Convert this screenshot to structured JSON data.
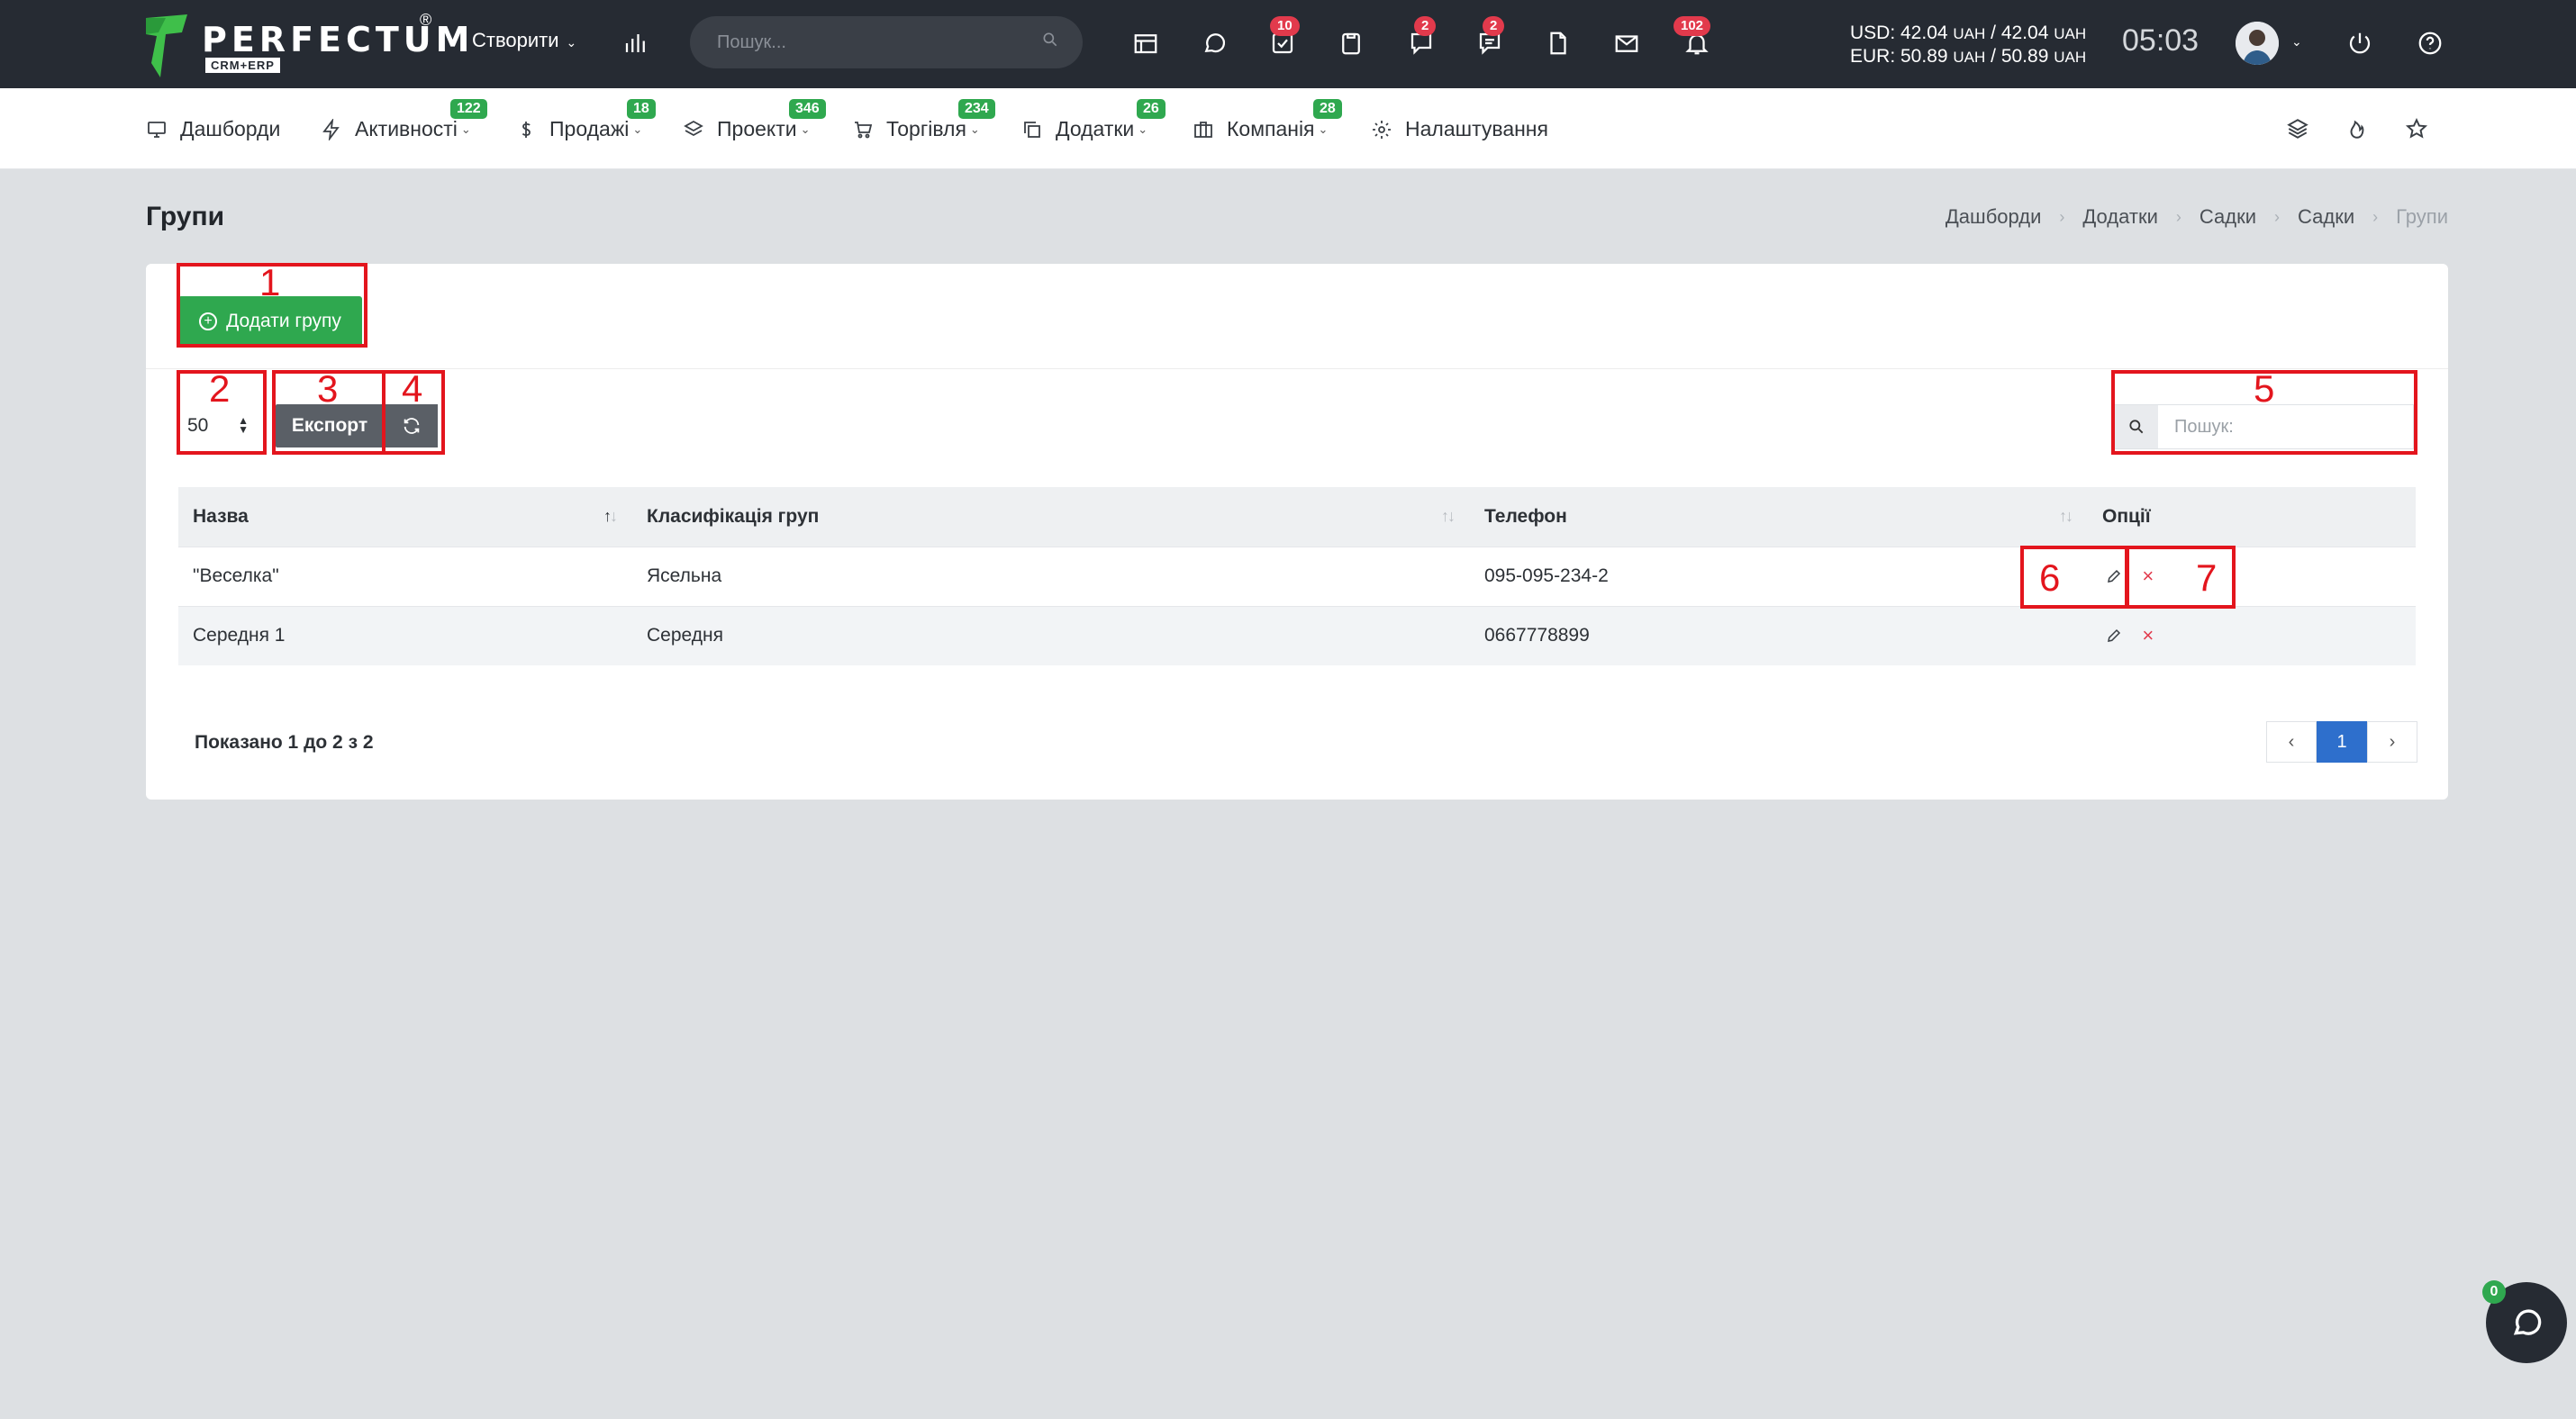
{
  "topbar": {
    "logo_text": "PERFECTUM",
    "logo_reg": "®",
    "logo_sub": "CRM+ERP",
    "create_label": "Створити",
    "search_placeholder": "Пошук...",
    "badges": {
      "tasks": "10",
      "chats": "2",
      "comments": "2",
      "notifications": "102"
    },
    "rates": {
      "usd": "USD: 42.04",
      "usd_mid": "/ 42.04",
      "eur": "EUR: 50.89",
      "eur_mid": "/ 50.89",
      "unit": "UAH"
    },
    "clock": "05:03"
  },
  "nav": {
    "items": [
      {
        "label": "Дашборди",
        "icon": "monitor-icon",
        "badge": ""
      },
      {
        "label": "Активності",
        "icon": "lightning-icon",
        "badge": "122"
      },
      {
        "label": "Продажі",
        "icon": "dollar-icon",
        "badge": "18"
      },
      {
        "label": "Проекти",
        "icon": "layers-icon",
        "badge": "346"
      },
      {
        "label": "Торгівля",
        "icon": "cart-icon",
        "badge": "234"
      },
      {
        "label": "Додатки",
        "icon": "copy-icon",
        "badge": "26"
      },
      {
        "label": "Компанія",
        "icon": "briefcase-icon",
        "badge": "28"
      },
      {
        "label": "Налаштування",
        "icon": "gear-icon",
        "badge": ""
      }
    ]
  },
  "page": {
    "title": "Групи",
    "breadcrumb": [
      "Дашборди",
      "Додатки",
      "Садки",
      "Садки",
      "Групи"
    ]
  },
  "toolbar": {
    "add_label": "Додати групу",
    "length_value": "50",
    "export_label": "Експорт",
    "search_placeholder": "Пошук:"
  },
  "table": {
    "columns": [
      "Назва",
      "Класифікація груп",
      "Телефон",
      "Опції"
    ],
    "rows": [
      {
        "name": "\"Веселка\"",
        "classification": "Ясельна",
        "phone": "095-095-234-2"
      },
      {
        "name": "Середня 1",
        "classification": "Середня",
        "phone": "0667778899"
      }
    ]
  },
  "footer": {
    "info": "Показано 1 до 2 з 2",
    "prev": "‹",
    "page": "1",
    "next": "›"
  },
  "annotations": [
    "1",
    "2",
    "3",
    "4",
    "5",
    "6",
    "7"
  ],
  "chat_badge": "0",
  "colors": {
    "topbar": "#262b33",
    "green": "#2fa84f",
    "red_badge": "#e23a4c",
    "annotation": "#e3151d",
    "pager_active": "#2e6fcc"
  }
}
